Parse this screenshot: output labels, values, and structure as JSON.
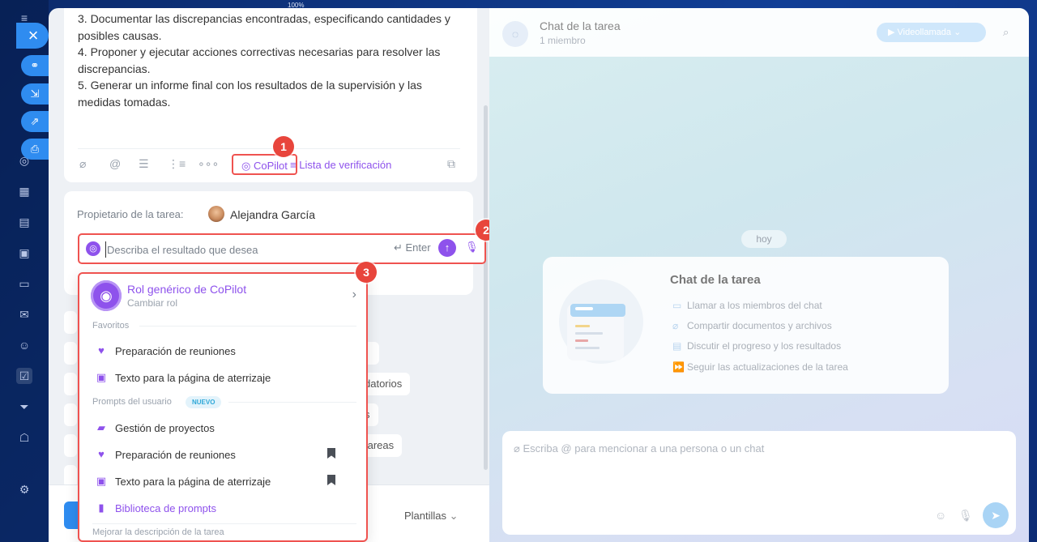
{
  "zoom": "100%",
  "close_glyph": "×",
  "task": {
    "description_lines": [
      "3. Documentar las discrepancias encontradas, especificando cantidades y posibles causas.",
      "4. Proponer y ejecutar acciones correctivas necesarias para resolver las discrepancias.",
      "5. Generar un informe final con los resultados de la supervisión y las medidas tomadas."
    ],
    "toolbar": {
      "copilot_label": "CoPilot",
      "checklist_label": "Lista de verificación"
    },
    "owner_label": "Propietario de la tarea:",
    "owner_name": "Alejandra García"
  },
  "copilot": {
    "placeholder": "Describa el resultado que desea",
    "enter_hint": "↵ Enter",
    "role": {
      "title": "Rol genérico de CoPilot",
      "subtitle": "Cambiar rol"
    },
    "sections": {
      "favorites": "Favoritos",
      "user_prompts": "Prompts del usuario",
      "new_badge": "NUEVO",
      "improve": "Mejorar la descripción de la tarea"
    },
    "favorites": [
      {
        "label": "Preparación de reuniones",
        "icon": "handshake-icon"
      },
      {
        "label": "Texto para la página de aterrizaje",
        "icon": "image-icon"
      }
    ],
    "user_prompts": [
      {
        "label": "Gestión de proyectos",
        "icon": "briefcase-icon"
      },
      {
        "label": "Preparación de reuniones",
        "icon": "handshake-icon"
      },
      {
        "label": "Texto para la página de aterrizaje",
        "icon": "image-icon"
      }
    ],
    "library": "Biblioteca de prompts"
  },
  "callouts": [
    "1",
    "2",
    "3"
  ],
  "background_chips": {
    "chip_a": "datorios",
    "chip_b": "s",
    "chip_c": "tareas"
  },
  "footer": {
    "templates_label": "Plantillas"
  },
  "chat": {
    "title": "Chat de la tarea",
    "members": "1 miembro",
    "video_label": "Videollamada",
    "day": "hoy",
    "welcome_title": "Chat de la tarea",
    "features": [
      {
        "label": "Llamar a los miembros del chat",
        "icon": "video-icon"
      },
      {
        "label": "Compartir documentos y archivos",
        "icon": "paperclip-icon"
      },
      {
        "label": "Discutir el progreso y los resultados",
        "icon": "document-icon"
      },
      {
        "label": "Seguir las actualizaciones de la tarea",
        "icon": "forward-icon"
      }
    ],
    "input_placeholder": "Escriba @ para mencionar a una persona o un chat"
  },
  "colors": {
    "accent": "#8e52ec",
    "highlight": "#ef5350",
    "primary": "#2f8cf0"
  }
}
